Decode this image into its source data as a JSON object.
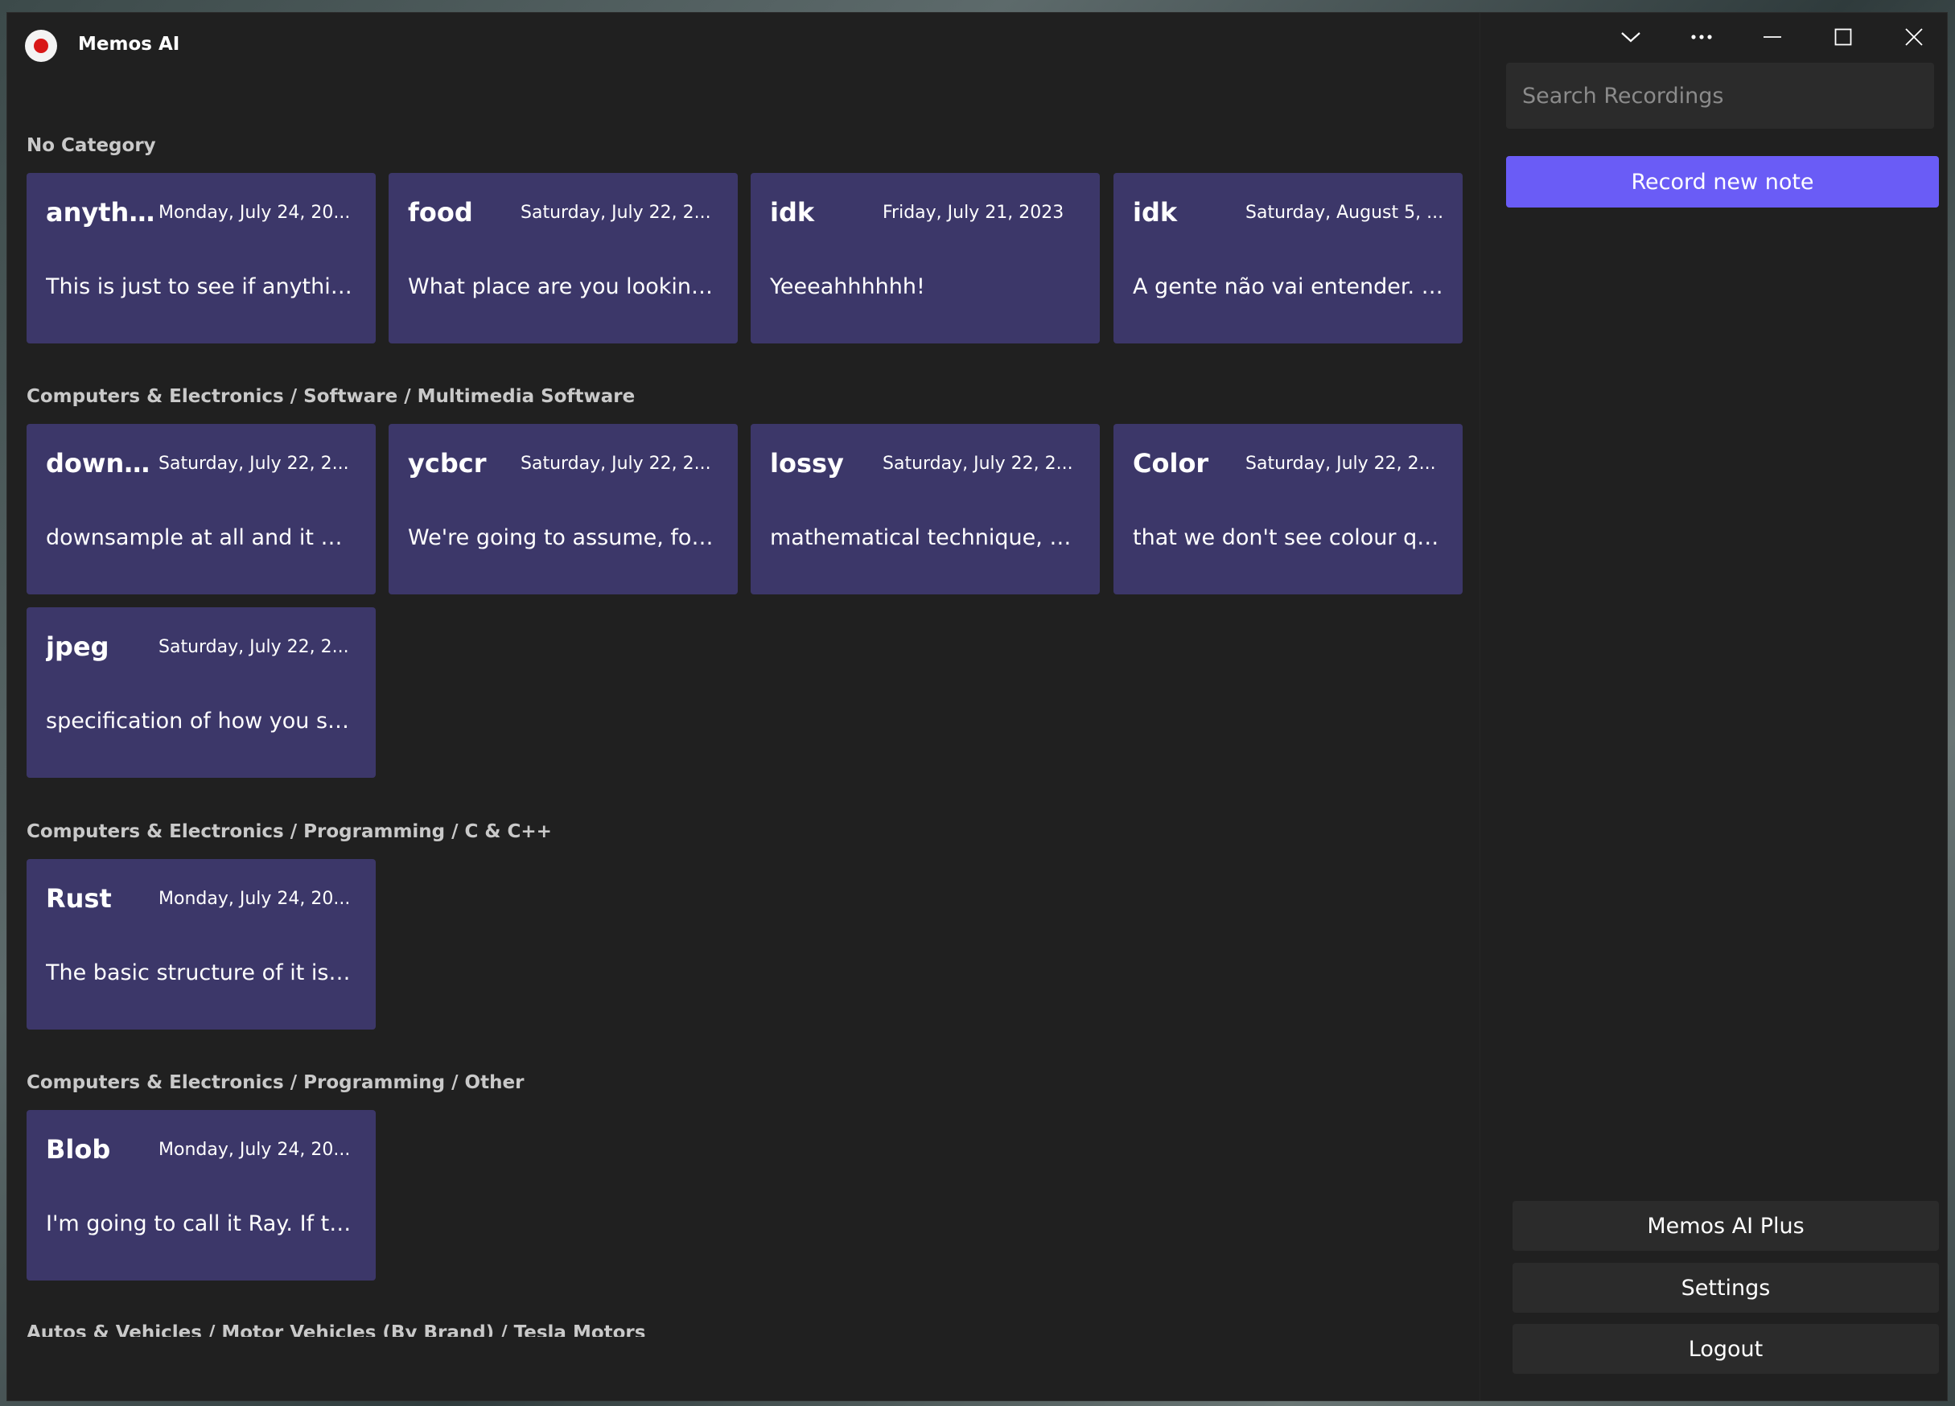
{
  "app": {
    "title": "Memos AI"
  },
  "categories": [
    {
      "name": "No Category",
      "cards": [
        {
          "title": "anythi...",
          "date": "Monday, July 24, 20...",
          "preview": "This is just to see if anything ..."
        },
        {
          "title": "food",
          "date": "Saturday, July 22, 2...",
          "preview": "What place are you looking a..."
        },
        {
          "title": "idk",
          "date": "Friday, July 21, 2023",
          "preview": "Yeeeahhhhhh!"
        },
        {
          "title": "idk",
          "date": "Saturday, August 5, ...",
          "preview": "A gente não vai entender. A ..."
        }
      ]
    },
    {
      "name": "Computers & Electronics / Software / Multimedia Software",
      "cards": [
        {
          "title": "downs...",
          "date": "Saturday, July 22, 2...",
          "preview": "downsample at all and it will ..."
        },
        {
          "title": "ycbcr",
          "date": "Saturday, July 22, 2...",
          "preview": "We're going to assume, for th..."
        },
        {
          "title": "lossy",
          "date": "Saturday, July 22, 2...",
          "preview": "mathematical technique, whi..."
        },
        {
          "title": "Color",
          "date": "Saturday, July 22, 2...",
          "preview": "that we don't see colour quit..."
        },
        {
          "title": "jpeg",
          "date": "Saturday, July 22, 2...",
          "preview": "specification of how you sho..."
        }
      ]
    },
    {
      "name": "Computers & Electronics / Programming / C & C++",
      "cards": [
        {
          "title": "Rust",
          "date": "Monday, July 24, 20...",
          "preview": "The basic structure of it is goi..."
        }
      ]
    },
    {
      "name": "Computers & Electronics / Programming / Other",
      "cards": [
        {
          "title": "Blob",
          "date": "Monday, July 24, 20...",
          "preview": "I'm going to call it Ray. If that..."
        }
      ]
    },
    {
      "name": "Autos & Vehicles / Motor Vehicles (By Brand) / Tesla Motors",
      "cards": []
    }
  ],
  "sidebar": {
    "search_placeholder": "Search Recordings",
    "record_label": "Record new note",
    "plus_label": "Memos AI Plus",
    "settings_label": "Settings",
    "logout_label": "Logout"
  },
  "window_controls": [
    "chevron-down-icon",
    "more-icon",
    "minimize-icon",
    "maximize-icon",
    "close-icon"
  ],
  "colors": {
    "window_bg": "#202020",
    "card_bg": "#3c3769",
    "accent": "#6a5cf6",
    "secondary_button": "#2b2b2b",
    "logo_dot": "#d81818"
  }
}
